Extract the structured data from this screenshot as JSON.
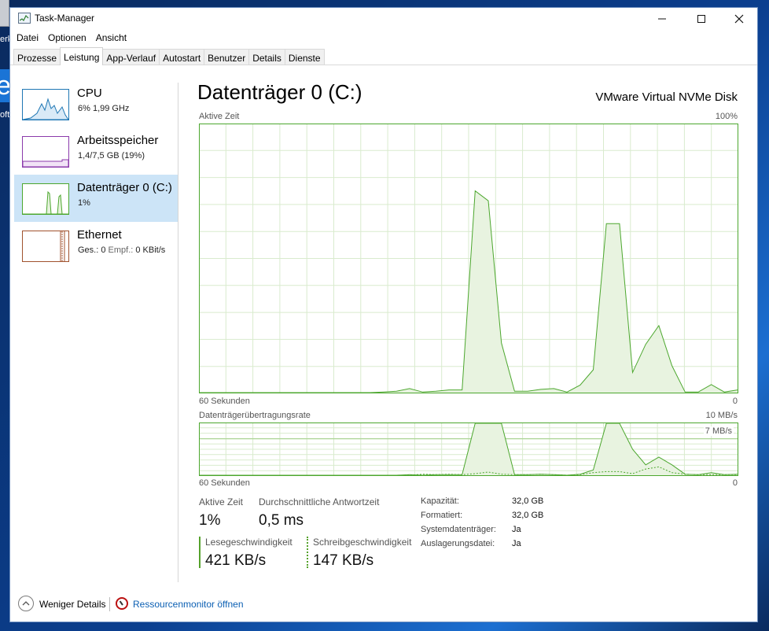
{
  "window": {
    "title": "Task-Manager"
  },
  "menu": [
    "Datei",
    "Optionen",
    "Ansicht"
  ],
  "tabs": [
    "Prozesse",
    "Leistung",
    "App-Verlauf",
    "Autostart",
    "Benutzer",
    "Details",
    "Dienste"
  ],
  "active_tab": "Leistung",
  "sidebar": [
    {
      "title": "CPU",
      "sub": "6%  1,99 GHz",
      "color": "#1f77b4"
    },
    {
      "title": "Arbeitsspeicher",
      "sub": "1,4/7,5 GB (19%)",
      "color": "#8b3aab"
    },
    {
      "title": "Datenträger 0 (C:)",
      "sub": "1%",
      "color": "#4ca72e",
      "selected": true
    },
    {
      "title": "Ethernet",
      "sub_prefix": "Ges.: 0 ",
      "sub_muted": "Empf.:",
      "sub_suffix": " 0 KBit/s",
      "color": "#a0522d"
    }
  ],
  "main": {
    "title": "Datenträger 0 (C:)",
    "device": "VMware Virtual NVMe Disk",
    "active_time_label": "Aktive Zeit",
    "active_time_max": "100%",
    "x_span_label": "60 Sekunden",
    "x_zero": "0",
    "transfer_label": "Datenträgerübertragungsrate",
    "transfer_max": "10 MB/s",
    "transfer_ref": "7 MB/s"
  },
  "stats": {
    "active_time": {
      "label": "Aktive Zeit",
      "value": "1%"
    },
    "avg_response": {
      "label": "Durchschnittliche Antwortzeit",
      "value": "0,5 ms"
    },
    "read_speed": {
      "label": "Lesegeschwindigkeit",
      "value": "421 KB/s"
    },
    "write_speed": {
      "label": "Schreibgeschwindigkeit",
      "value": "147 KB/s"
    }
  },
  "properties": [
    {
      "key": "Kapazität:",
      "value": "32,0 GB"
    },
    {
      "key": "Formatiert:",
      "value": "32,0 GB"
    },
    {
      "key": "Systemdatenträger:",
      "value": "Ja"
    },
    {
      "key": "Auslagerungsdatei:",
      "value": "Ja"
    }
  ],
  "footer": {
    "less_details": "Weniger Details",
    "resource_monitor": "Ressourcenmonitor öffnen"
  },
  "desktop": {
    "label_1": "erk",
    "label_2": "oft"
  },
  "chart_data": [
    {
      "type": "area",
      "title": "Aktive Zeit",
      "xlabel": "60 Sekunden",
      "ylim": [
        0,
        100
      ],
      "x": [
        60,
        58,
        56,
        54,
        52,
        50,
        48,
        46,
        44,
        42,
        40,
        38,
        36,
        34,
        32,
        30,
        28,
        26,
        24,
        22,
        20,
        18,
        16,
        14,
        12,
        10,
        8,
        6,
        4,
        2,
        0
      ],
      "series": [
        {
          "values": [
            0,
            0,
            0,
            0,
            0,
            0,
            0,
            0,
            0,
            0,
            0,
            0,
            0,
            0,
            0.2,
            0.5,
            1.5,
            0.2,
            0.5,
            1.0,
            1.0,
            75.2,
            71.5,
            18.5,
            0.5,
            0.5,
            1.2,
            1.5,
            0.2,
            2.8,
            8.5,
            63.0,
            63.0,
            7.5,
            18.0,
            25.0,
            10.0,
            0.2,
            0.2,
            3.0,
            0.2,
            1.0
          ]
        }
      ],
      "color": "#4ca72e",
      "grid": true
    },
    {
      "type": "line",
      "title": "Datenträgerübertragungsrate",
      "xlabel": "60 Sekunden",
      "ylim": [
        0,
        10
      ],
      "ylabel": "MB/s",
      "reference_line": 7,
      "series": [
        {
          "style": "solid",
          "values": [
            0,
            0,
            0,
            0,
            0,
            0,
            0,
            0,
            0,
            0,
            0,
            0,
            0,
            0,
            0,
            0,
            0.1,
            0,
            0.1,
            0.1,
            0.1,
            10,
            10,
            10,
            0.1,
            0.1,
            0.2,
            0.1,
            0,
            0.2,
            1.0,
            10,
            10,
            5.0,
            2.0,
            3.5,
            2.0,
            0.2,
            0.1,
            0.5,
            0.1,
            0.2
          ]
        },
        {
          "style": "dotted",
          "values": [
            0,
            0,
            0,
            0,
            0,
            0,
            0,
            0,
            0,
            0,
            0,
            0,
            0,
            0,
            0,
            0,
            0,
            0.2,
            0.1,
            0.2,
            0.1,
            0.3,
            0.6,
            0.2,
            0.1,
            0.1,
            0.2,
            0.1,
            0,
            0.1,
            0.5,
            0.7,
            0.7,
            0.3,
            1.2,
            1.6,
            0.5,
            0.2,
            0.1,
            0.1,
            0.1,
            0.1
          ]
        }
      ],
      "color": "#4ca72e",
      "grid": true
    }
  ]
}
